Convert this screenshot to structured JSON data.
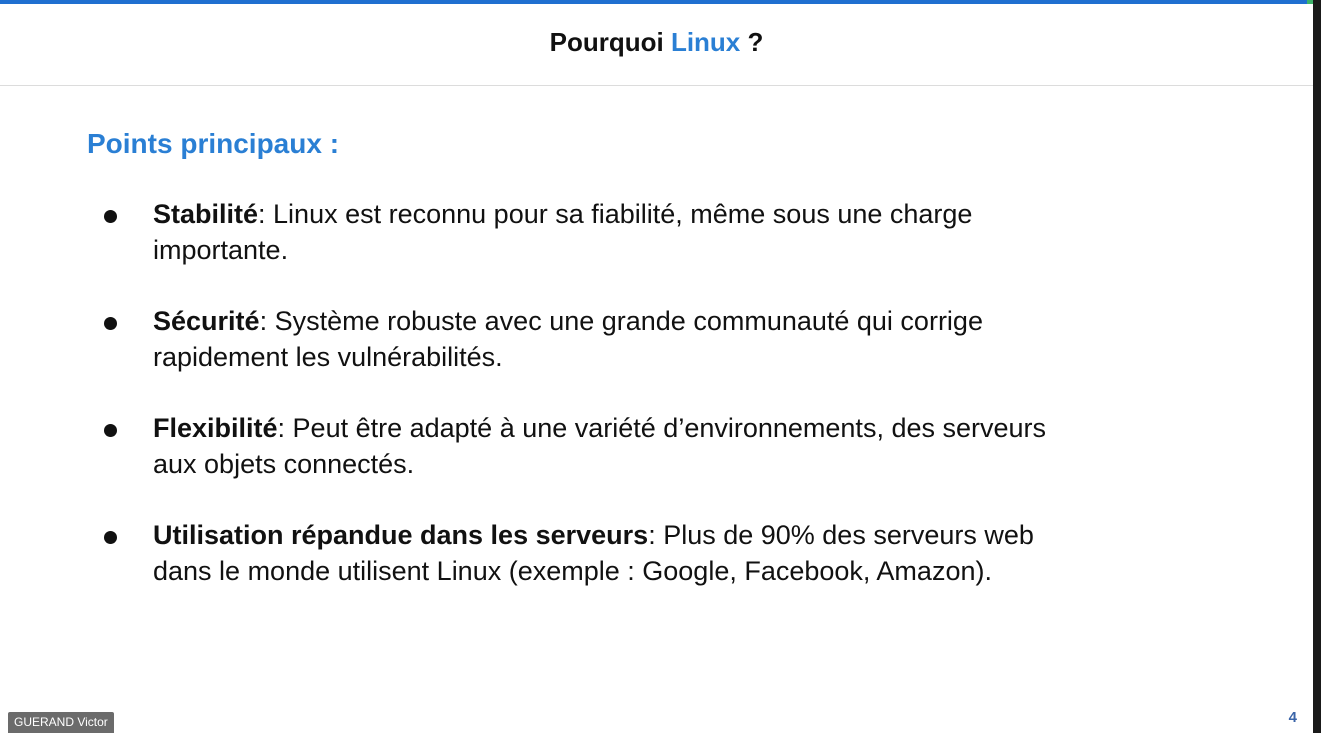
{
  "colors": {
    "accent": "#2a7fd4",
    "text": "#111111",
    "top_bar": "#1f6fd0",
    "page_number": "#3a64a8"
  },
  "slide": {
    "title_prefix": "Pourquoi ",
    "title_accent": "Linux",
    "title_suffix": " ?",
    "section_heading": "Points principaux :",
    "bullets": [
      {
        "term": "Stabilité",
        "text": ": Linux est reconnu pour sa fiabilité, même sous une charge importante."
      },
      {
        "term": "Sécurité",
        "text": ": Système robuste avec une grande communauté qui corrige rapidement les vulnérabilités."
      },
      {
        "term": "Flexibilité",
        "text": ": Peut être adapté à une variété d’environnements, des serveurs aux objets connectés."
      },
      {
        "term": "Utilisation répandue dans les serveurs",
        "text": ": Plus de 90% des serveurs web dans le monde utilisent Linux (exemple : Google, Facebook, Amazon)."
      }
    ],
    "page_number": "4"
  },
  "presenter": {
    "name": "GUERAND Victor"
  }
}
